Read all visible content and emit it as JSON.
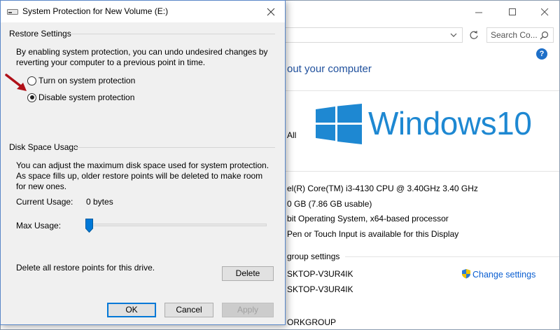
{
  "background_window": {
    "search_placeholder": "Search Co...",
    "heading": "out your computer",
    "logo_text": "Windows10",
    "edition_fragment": "All",
    "processor": "el(R) Core(TM) i3-4130 CPU @ 3.40GHz   3.40 GHz",
    "memory": "0 GB (7.86 GB usable)",
    "system_type": "bit Operating System, x64-based processor",
    "pen_touch": "Pen or Touch Input is available for this Display",
    "workgroup_heading": "group settings",
    "computer_name": "SKTOP-V3UR4IK",
    "full_computer_name": "SKTOP-V3UR4IK",
    "workgroup": "ORKGROUP",
    "change_settings": "Change settings",
    "help": "?",
    "colors": {
      "logo": "#1e88d2",
      "link": "#0b5fd1"
    }
  },
  "dialog": {
    "title": "System Protection for New Volume (E:)",
    "restore_settings": {
      "group_label": "Restore Settings",
      "description": "By enabling system protection, you can undo undesired changes by reverting your computer to a previous point in time.",
      "options": [
        {
          "label": "Turn on system protection",
          "selected": false
        },
        {
          "label": "Disable system protection",
          "selected": true
        }
      ]
    },
    "disk_space": {
      "group_label": "Disk Space Usage",
      "description": "You can adjust the maximum disk space used for system protection. As space fills up, older restore points will be deleted to make room for new ones.",
      "current_usage_label": "Current Usage:",
      "current_usage_value": "0 bytes",
      "max_usage_label": "Max Usage:",
      "max_usage_fraction": 0.0
    },
    "delete_text": "Delete all restore points for this drive.",
    "buttons": {
      "delete": "Delete",
      "ok": "OK",
      "cancel": "Cancel",
      "apply": "Apply"
    }
  }
}
